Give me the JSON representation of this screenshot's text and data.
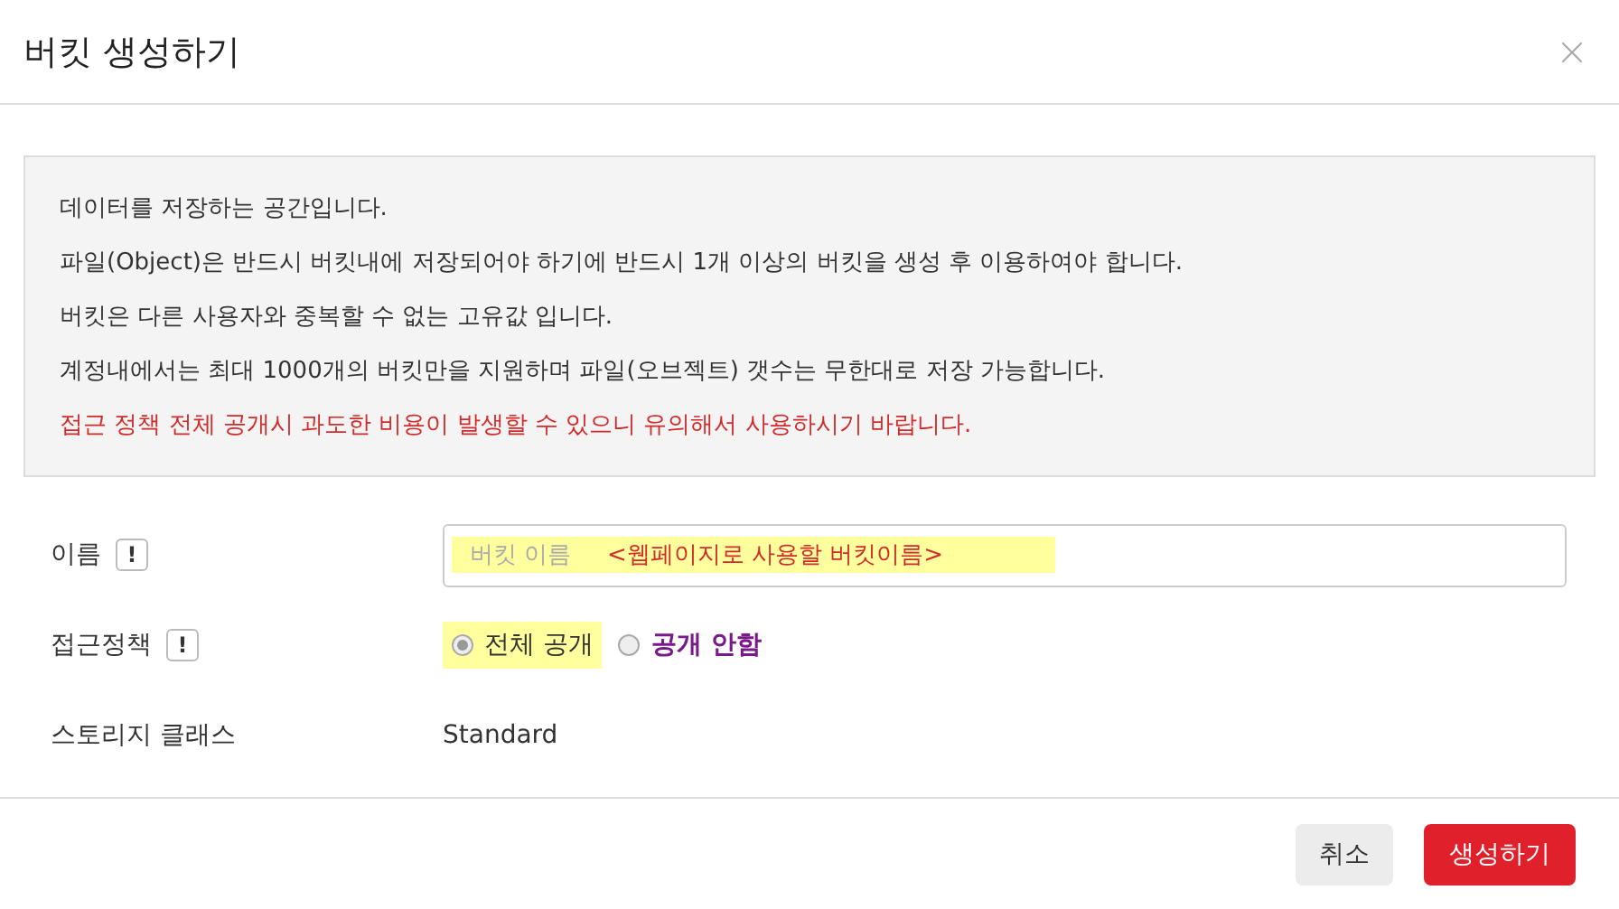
{
  "dialog": {
    "title": "버킷 생성하기"
  },
  "notice": {
    "lines": [
      {
        "text": "데이터를 저장하는 공간입니다.",
        "kind": "normal"
      },
      {
        "text": "파일(Object)은 반드시 버킷내에 저장되어야 하기에 반드시 1개 이상의 버킷을 생성 후 이용하여야 합니다.",
        "kind": "normal"
      },
      {
        "text": "버킷은 다른 사용자와 중복할 수 없는 고유값 입니다.",
        "kind": "normal"
      },
      {
        "text": "계정내에서는 최대 1000개의 버킷만을 지원하며 파일(오브젝트) 갯수는 무한대로 저장 가능합니다.",
        "kind": "normal"
      },
      {
        "text": "접근 정책 전체 공개시 과도한 비용이 발생할 수 있으니 유의해서 사용하시기 바랍니다.",
        "kind": "warning"
      }
    ]
  },
  "fields": [
    {
      "kind": "input",
      "label": "이름",
      "info": "!",
      "placeholder": "버킷 이름",
      "annotation": "<웹페이지로 사용할 버킷이름>"
    },
    {
      "kind": "radio",
      "label": "접근정책",
      "info": "!",
      "options": [
        {
          "label": "전체 공개",
          "selected": true
        },
        {
          "label": "공개 안함",
          "selected": false
        }
      ]
    },
    {
      "kind": "text",
      "label": "스토리지 클래스",
      "value": "Standard"
    }
  ],
  "buttons": [
    {
      "label": "취소",
      "kind": "secondary"
    },
    {
      "label": "생성하기",
      "kind": "primary"
    }
  ]
}
